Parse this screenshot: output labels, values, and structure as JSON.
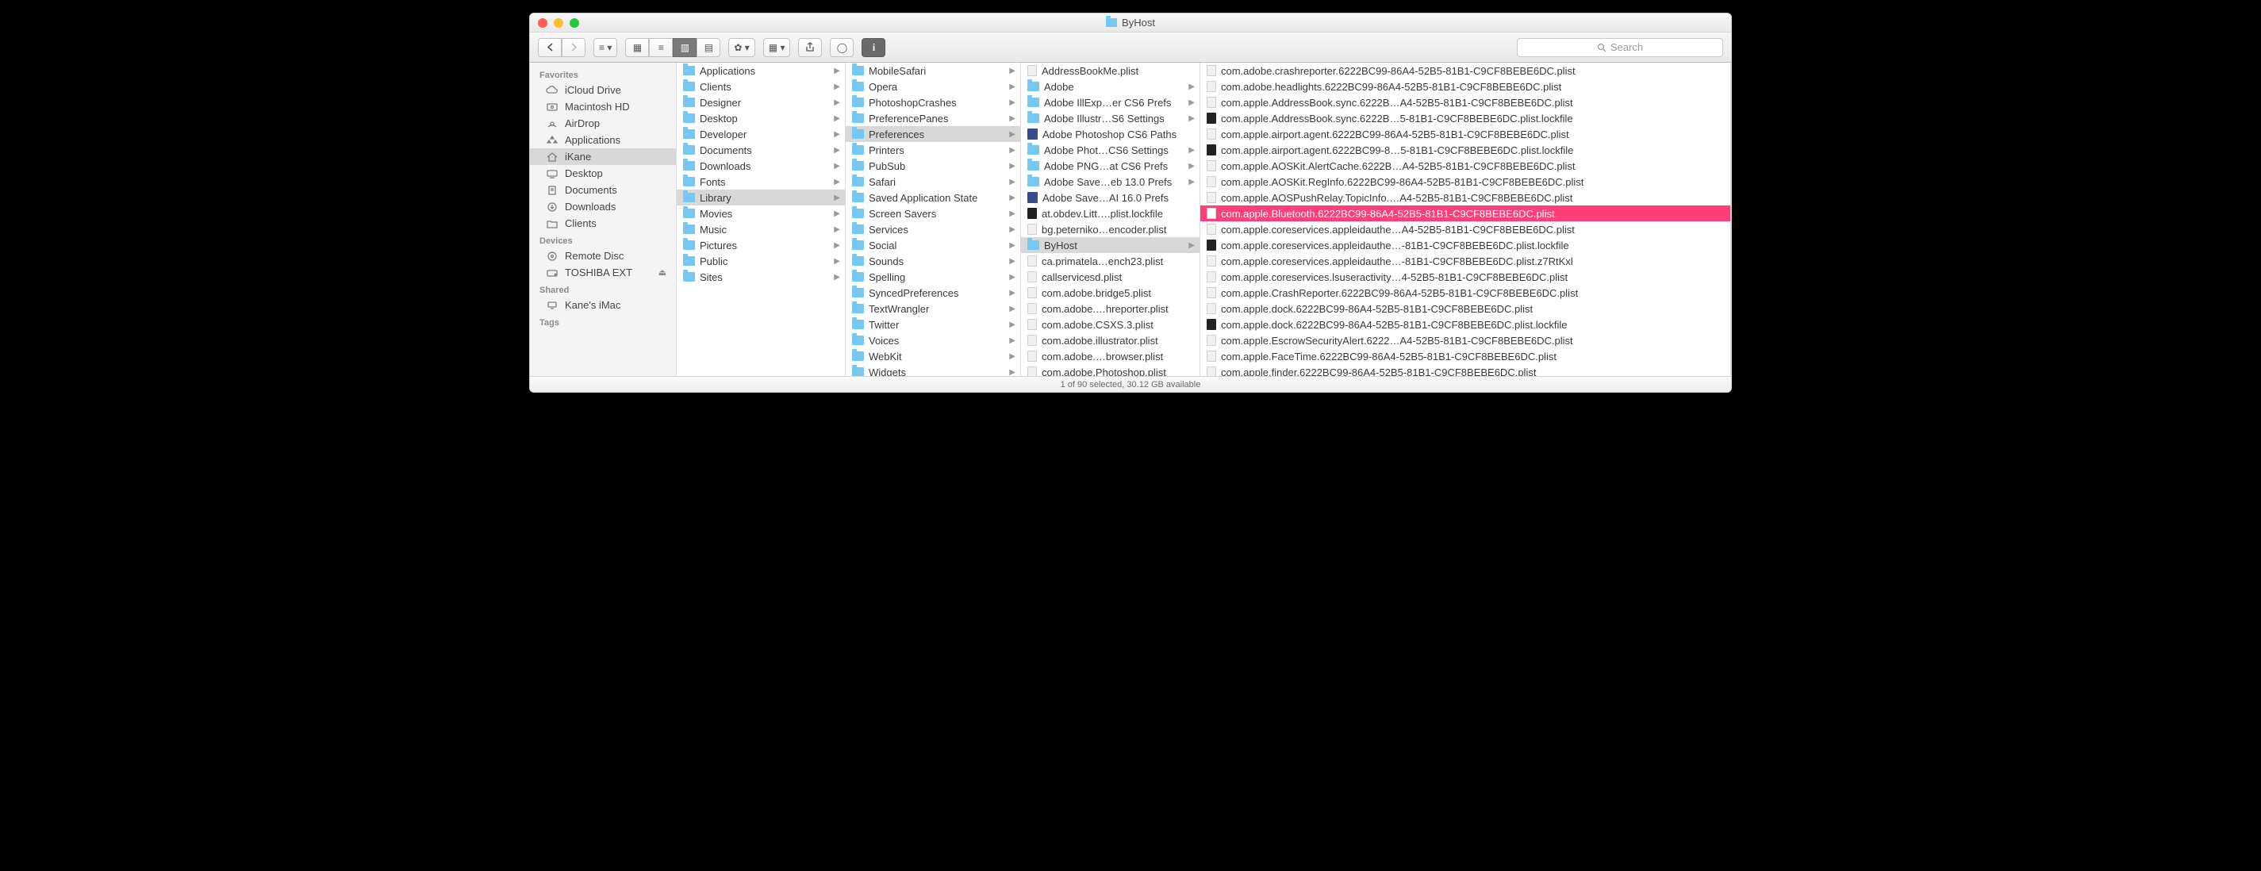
{
  "window": {
    "title": "ByHost"
  },
  "toolbar": {
    "search_placeholder": "Search"
  },
  "sidebar": {
    "sections": [
      {
        "header": "Favorites",
        "items": [
          {
            "icon": "cloud",
            "label": "iCloud Drive"
          },
          {
            "icon": "disk",
            "label": "Macintosh HD"
          },
          {
            "icon": "airdrop",
            "label": "AirDrop"
          },
          {
            "icon": "apps",
            "label": "Applications"
          },
          {
            "icon": "home",
            "label": "iKane",
            "selected": true
          },
          {
            "icon": "desk",
            "label": "Desktop"
          },
          {
            "icon": "docs",
            "label": "Documents"
          },
          {
            "icon": "down",
            "label": "Downloads"
          },
          {
            "icon": "fld",
            "label": "Clients"
          }
        ]
      },
      {
        "header": "Devices",
        "items": [
          {
            "icon": "disc",
            "label": "Remote Disc"
          },
          {
            "icon": "ext",
            "label": "TOSHIBA EXT",
            "eject": true
          }
        ]
      },
      {
        "header": "Shared",
        "items": [
          {
            "icon": "net",
            "label": "Kane's iMac"
          }
        ]
      },
      {
        "header": "Tags",
        "items": []
      }
    ]
  },
  "columns": [
    {
      "selected": "Library",
      "items": [
        {
          "t": "fld",
          "n": "Applications",
          "a": true
        },
        {
          "t": "fld",
          "n": "Clients",
          "a": true
        },
        {
          "t": "fld",
          "n": "Designer",
          "a": true
        },
        {
          "t": "fld",
          "n": "Desktop",
          "a": true
        },
        {
          "t": "fld",
          "n": "Developer",
          "a": true
        },
        {
          "t": "fld",
          "n": "Documents",
          "a": true
        },
        {
          "t": "fld",
          "n": "Downloads",
          "a": true
        },
        {
          "t": "fld",
          "n": "Fonts",
          "a": true
        },
        {
          "t": "fld",
          "n": "Library",
          "a": true,
          "sel": true
        },
        {
          "t": "fld",
          "n": "Movies",
          "a": true
        },
        {
          "t": "fld",
          "n": "Music",
          "a": true
        },
        {
          "t": "fld",
          "n": "Pictures",
          "a": true
        },
        {
          "t": "fld",
          "n": "Public",
          "a": true
        },
        {
          "t": "fld",
          "n": "Sites",
          "a": true
        }
      ]
    },
    {
      "selected": "Preferences",
      "items": [
        {
          "t": "fld",
          "n": "MobileSafari",
          "a": true
        },
        {
          "t": "fld",
          "n": "Opera",
          "a": true
        },
        {
          "t": "fld",
          "n": "PhotoshopCrashes",
          "a": true
        },
        {
          "t": "fld",
          "n": "PreferencePanes",
          "a": true
        },
        {
          "t": "fld",
          "n": "Preferences",
          "a": true,
          "sel": true
        },
        {
          "t": "fld",
          "n": "Printers",
          "a": true
        },
        {
          "t": "fld",
          "n": "PubSub",
          "a": true
        },
        {
          "t": "fld",
          "n": "Safari",
          "a": true
        },
        {
          "t": "fld",
          "n": "Saved Application State",
          "a": true
        },
        {
          "t": "fld",
          "n": "Screen Savers",
          "a": true
        },
        {
          "t": "fld",
          "n": "Services",
          "a": true
        },
        {
          "t": "fld",
          "n": "Social",
          "a": true
        },
        {
          "t": "fld",
          "n": "Sounds",
          "a": true
        },
        {
          "t": "fld",
          "n": "Spelling",
          "a": true
        },
        {
          "t": "fld",
          "n": "SyncedPreferences",
          "a": true
        },
        {
          "t": "fld",
          "n": "TextWrangler",
          "a": true
        },
        {
          "t": "fld",
          "n": "Twitter",
          "a": true
        },
        {
          "t": "fld",
          "n": "Voices",
          "a": true
        },
        {
          "t": "fld",
          "n": "WebKit",
          "a": true
        },
        {
          "t": "fld",
          "n": "Widgets",
          "a": true
        }
      ]
    },
    {
      "selected": "ByHost",
      "items": [
        {
          "t": "doc",
          "n": "AddressBookMe.plist"
        },
        {
          "t": "fld",
          "n": "Adobe",
          "a": true
        },
        {
          "t": "fld",
          "n": "Adobe IllExp…er CS6 Prefs",
          "a": true
        },
        {
          "t": "fld",
          "n": "Adobe Illustr…S6 Settings",
          "a": true
        },
        {
          "t": "q",
          "n": "Adobe Photoshop CS6 Paths"
        },
        {
          "t": "fld",
          "n": "Adobe Phot…CS6 Settings",
          "a": true
        },
        {
          "t": "fld",
          "n": "Adobe PNG…at CS6 Prefs",
          "a": true
        },
        {
          "t": "fld",
          "n": "Adobe Save…eb 13.0 Prefs",
          "a": true
        },
        {
          "t": "q",
          "n": "Adobe Save…AI 16.0 Prefs"
        },
        {
          "t": "blk",
          "n": "at.obdev.Litt….plist.lockfile"
        },
        {
          "t": "doc",
          "n": "bg.peterniko…encoder.plist"
        },
        {
          "t": "fld",
          "n": "ByHost",
          "a": true,
          "sel": true
        },
        {
          "t": "doc",
          "n": "ca.primatela…ench23.plist"
        },
        {
          "t": "doc",
          "n": "callservicesd.plist"
        },
        {
          "t": "doc",
          "n": "com.adobe.bridge5.plist"
        },
        {
          "t": "doc",
          "n": "com.adobe.…hreporter.plist"
        },
        {
          "t": "doc",
          "n": "com.adobe.CSXS.3.plist"
        },
        {
          "t": "doc",
          "n": "com.adobe.illustrator.plist"
        },
        {
          "t": "doc",
          "n": "com.adobe.…browser.plist"
        },
        {
          "t": "doc",
          "n": "com.adobe.Photoshop.plist"
        }
      ]
    },
    {
      "items": [
        {
          "t": "doc",
          "n": "com.adobe.crashreporter.6222BC99-86A4-52B5-81B1-C9CF8BEBE6DC.plist"
        },
        {
          "t": "doc",
          "n": "com.adobe.headlights.6222BC99-86A4-52B5-81B1-C9CF8BEBE6DC.plist"
        },
        {
          "t": "doc",
          "n": "com.apple.AddressBook.sync.6222B…A4-52B5-81B1-C9CF8BEBE6DC.plist"
        },
        {
          "t": "blk",
          "n": "com.apple.AddressBook.sync.6222B…5-81B1-C9CF8BEBE6DC.plist.lockfile"
        },
        {
          "t": "doc",
          "n": "com.apple.airport.agent.6222BC99-86A4-52B5-81B1-C9CF8BEBE6DC.plist"
        },
        {
          "t": "blk",
          "n": "com.apple.airport.agent.6222BC99-8…5-81B1-C9CF8BEBE6DC.plist.lockfile"
        },
        {
          "t": "doc",
          "n": "com.apple.AOSKit.AlertCache.6222B…A4-52B5-81B1-C9CF8BEBE6DC.plist"
        },
        {
          "t": "doc",
          "n": "com.apple.AOSKit.RegInfo.6222BC99-86A4-52B5-81B1-C9CF8BEBE6DC.plist"
        },
        {
          "t": "doc",
          "n": "com.apple.AOSPushRelay.TopicInfo.…A4-52B5-81B1-C9CF8BEBE6DC.plist"
        },
        {
          "t": "doc",
          "n": "com.apple.Bluetooth.6222BC99-86A4-52B5-81B1-C9CF8BEBE6DC.plist",
          "hl": true
        },
        {
          "t": "doc",
          "n": "com.apple.coreservices.appleidauthe…A4-52B5-81B1-C9CF8BEBE6DC.plist"
        },
        {
          "t": "blk",
          "n": "com.apple.coreservices.appleidauthe…-81B1-C9CF8BEBE6DC.plist.lockfile"
        },
        {
          "t": "doc",
          "n": "com.apple.coreservices.appleidauthe…-81B1-C9CF8BEBE6DC.plist.z7RtKxl"
        },
        {
          "t": "doc",
          "n": "com.apple.coreservices.lsuseractivity…4-52B5-81B1-C9CF8BEBE6DC.plist"
        },
        {
          "t": "doc",
          "n": "com.apple.CrashReporter.6222BC99-86A4-52B5-81B1-C9CF8BEBE6DC.plist"
        },
        {
          "t": "doc",
          "n": "com.apple.dock.6222BC99-86A4-52B5-81B1-C9CF8BEBE6DC.plist"
        },
        {
          "t": "blk",
          "n": "com.apple.dock.6222BC99-86A4-52B5-81B1-C9CF8BEBE6DC.plist.lockfile"
        },
        {
          "t": "doc",
          "n": "com.apple.EscrowSecurityAlert.6222…A4-52B5-81B1-C9CF8BEBE6DC.plist"
        },
        {
          "t": "doc",
          "n": "com.apple.FaceTime.6222BC99-86A4-52B5-81B1-C9CF8BEBE6DC.plist"
        },
        {
          "t": "doc",
          "n": "com.apple.finder.6222BC99-86A4-52B5-81B1-C9CF8BEBE6DC.plist"
        }
      ]
    }
  ],
  "status": "1 of 90 selected, 30.12 GB available"
}
